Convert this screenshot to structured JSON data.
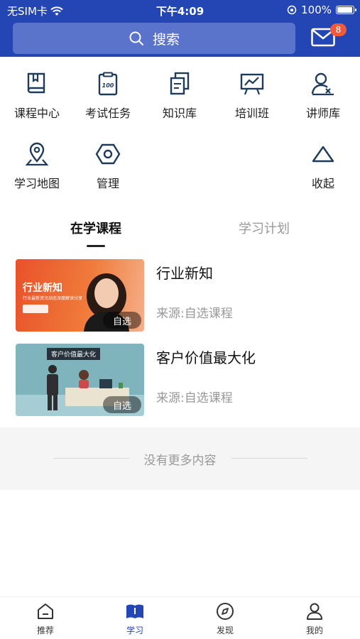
{
  "status_bar": {
    "carrier": "无SIM卡",
    "time": "下午4:09",
    "battery_text": "100%",
    "battery_level": 1.0
  },
  "header": {
    "search_label": "搜索",
    "mail_badge": "8"
  },
  "grid": [
    {
      "label": "课程中心",
      "icon": "book-icon"
    },
    {
      "label": "考试任务",
      "icon": "exam-clipboard-icon"
    },
    {
      "label": "知识库",
      "icon": "documents-icon"
    },
    {
      "label": "培训班",
      "icon": "presentation-board-icon"
    },
    {
      "label": "讲师库",
      "icon": "lecturer-icon"
    },
    {
      "label": "学习地图",
      "icon": "map-pin-icon"
    },
    {
      "label": "管理",
      "icon": "hexagon-settings-icon"
    },
    {
      "label": "收起",
      "icon": "triangle-up-icon"
    }
  ],
  "tabs": [
    {
      "label": "在学课程",
      "active": true
    },
    {
      "label": "学习计划",
      "active": false
    }
  ],
  "courses": [
    {
      "title": "行业新知",
      "source": "来源:自选课程",
      "thumb_badge": "自选",
      "thumb_title": "行业新知",
      "thumb_subtitle": "行业最新资讯动态深度解读分享"
    },
    {
      "title": "客户价值最大化",
      "source": "来源:自选课程",
      "thumb_badge": "自选",
      "thumb_title": "客户价值最大化"
    }
  ],
  "no_more_text": "没有更多内容",
  "tabbar": [
    {
      "label": "推荐",
      "icon": "home-icon",
      "active": false
    },
    {
      "label": "学习",
      "icon": "open-book-icon",
      "active": true
    },
    {
      "label": "发现",
      "icon": "compass-icon",
      "active": false
    },
    {
      "label": "我的",
      "icon": "user-icon",
      "active": false
    }
  ],
  "colors": {
    "primary": "#2346b4",
    "badge": "#f05a3c",
    "search_bg": "#5a74cc"
  }
}
